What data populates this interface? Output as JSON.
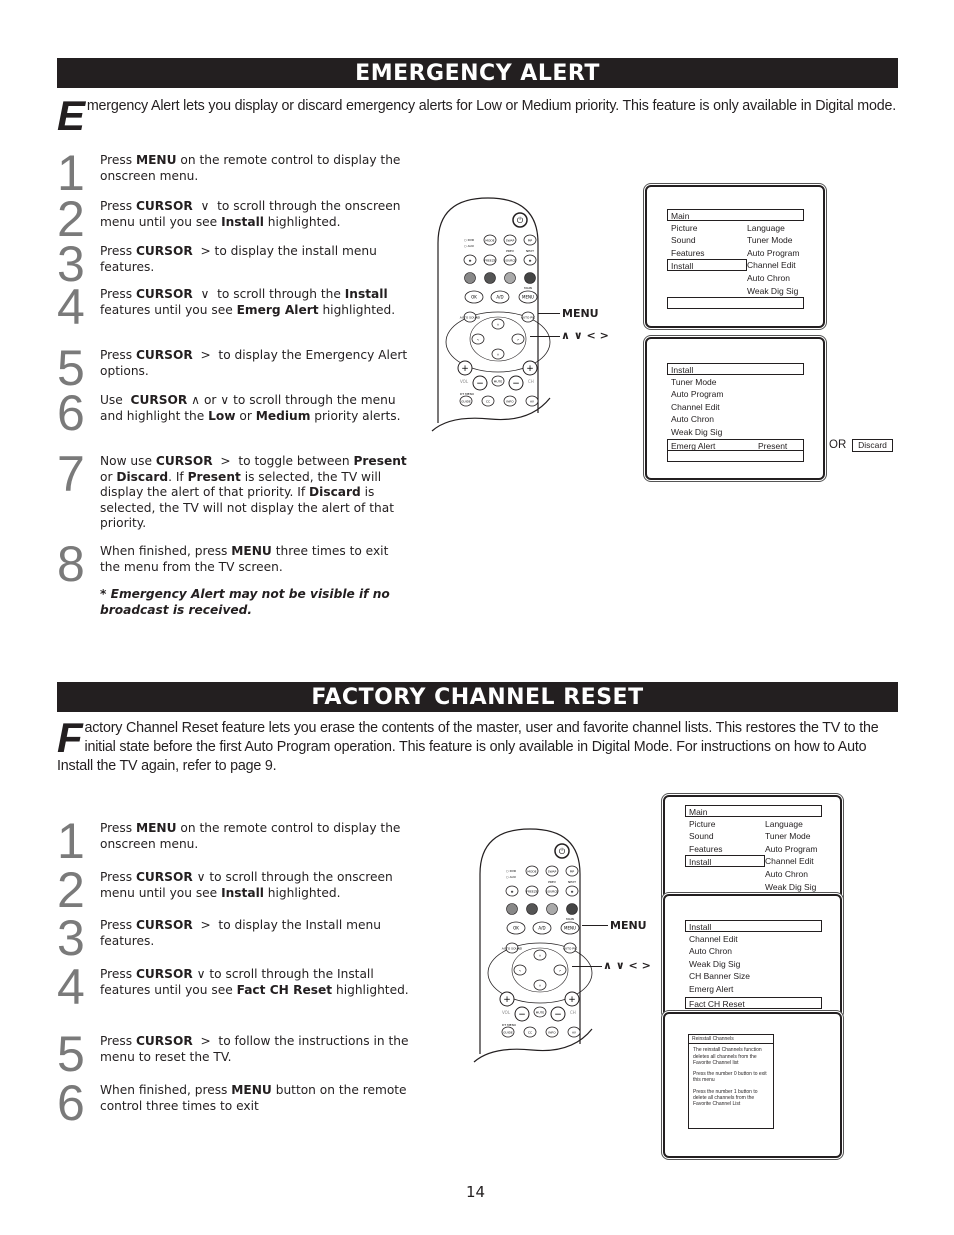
{
  "page_number": "14",
  "emergency_alert": {
    "title": "EMERGENCY ALERT",
    "intro_dropcap": "E",
    "intro": "mergency Alert lets you display or discard emergency alerts for Low or Medium priority.  This feature is only available in Digital mode.",
    "steps": [
      {
        "num": "1",
        "html": "Press <b>MENU</b> on the remote control to display the onscreen menu."
      },
      {
        "num": "2",
        "html": "Press <b>CURSOR</b> &nbsp;∨&nbsp; to scroll through the onscreen menu until you see <b>Install</b> highlighted."
      },
      {
        "num": "3",
        "html": "Press <b>CURSOR</b> &nbsp;&gt; to display the install menu features."
      },
      {
        "num": "4",
        "html": "Press <b>CURSOR</b> &nbsp;∨&nbsp; to scroll through the <b>Install</b> features until you see <b>Emerg Alert</b> highlighted."
      },
      {
        "num": "5",
        "html": "Press <b>CURSOR</b> &nbsp;&gt;&nbsp; to display the Emergency Alert options."
      },
      {
        "num": "6",
        "html": "Use &nbsp;<b>CURSOR</b> ∧ or ∨ to scroll through the menu and highlight the <b>Low</b> or <b>Medium</b> priority alerts."
      },
      {
        "num": "7",
        "html": "Now use <b>CURSOR</b> &nbsp;&gt;&nbsp; to toggle between <b>Present</b> or <b>Discard</b>.  If <b>Present</b> is selected, the TV will display the alert of that priority.   If <b>Discard</b> is selected,  the TV will not display the alert of that priority."
      },
      {
        "num": "8",
        "html": "When finished, press <b>MENU</b> three times to exit the menu from the TV screen."
      }
    ],
    "note": "*  Emergency Alert may not be visible if no broadcast is received.",
    "remote_labels": {
      "menu": "MENU",
      "cursor": "∧  ∨ < >"
    },
    "screen1": {
      "header": "Main",
      "left": [
        "Picture",
        "Sound",
        "Features",
        "Install"
      ],
      "right": [
        "Language",
        "Tuner Mode",
        "Auto Program",
        "Channel Edit",
        "Auto Chron",
        "Weak Dig Sig"
      ],
      "highlighted": "Install"
    },
    "screen2": {
      "header": "Install",
      "items": [
        "Tuner Mode",
        "Auto Program",
        "Channel Edit",
        "Auto Chron",
        "Weak Dig Sig"
      ],
      "selected_item": "Emerg Alert",
      "selected_value": "Present",
      "or_label": "OR",
      "alt_value": "Discard"
    }
  },
  "factory_reset": {
    "title": "FACTORY CHANNEL RESET",
    "intro_dropcap": "F",
    "intro": "actory Channel Reset feature lets you erase the contents of the master, user and favorite channel lists.  This restores the TV to the initial state before the first Auto Program operation.  This feature is only available in Digital Mode.   For instructions on how to Auto Install the TV again, refer to page 9.",
    "steps": [
      {
        "num": "1",
        "html": "Press <b>MENU</b> on the remote control to display the onscreen menu."
      },
      {
        "num": "2",
        "html": "Press <b>CURSOR</b> ∨ to scroll through the onscreen menu until you see <b>Install</b> highlighted."
      },
      {
        "num": "3",
        "html": "Press <b>CURSOR</b> &nbsp;&gt;&nbsp; to display the Install menu features."
      },
      {
        "num": "4",
        "html": "Press <b>CURSOR</b> ∨ to scroll through the Install features until you see <b>Fact CH Reset</b> highlighted."
      },
      {
        "num": "5",
        "html": "Press <b>CURSOR</b> &nbsp;&gt;&nbsp; to follow the instructions in the menu to reset the TV."
      },
      {
        "num": "6",
        "html": "When finished, press <b>MENU</b> button on the remote control three times to exit"
      }
    ],
    "remote_labels": {
      "menu": "MENU",
      "cursor": "∧  ∨ < >"
    },
    "screen1": {
      "header": "Main",
      "left": [
        "Picture",
        "Sound",
        "Features",
        "Install"
      ],
      "right": [
        "Language",
        "Tuner Mode",
        "Auto Program",
        "Channel Edit",
        "Auto Chron",
        "Weak Dig Sig"
      ],
      "highlighted": "Install"
    },
    "screen2": {
      "header": "Install",
      "items": [
        "Channel Edit",
        "Auto Chron",
        "Weak Dig Sig",
        "CH Banner Size",
        "Emerg Alert"
      ],
      "selected_item": "Fact CH Reset"
    },
    "screen3": {
      "title": "Reinstall Channels",
      "paragraphs": [
        "The reinstall Channels function deletes all channels from the Favorite Channel list",
        "Press the number 0 button to exit this menu",
        "Press the number 1 button to delete all channels from the Favorite Channel List"
      ]
    }
  },
  "remote_buttons": {
    "power": "⏻",
    "mode": "MODE",
    "swap": "SWAP",
    "pip": "PIP",
    "dvd": "○ DVD",
    "aux": "○ AUX",
    "freeze": "FREEZE",
    "source": "SOURCE",
    "ok": "OK",
    "ad": "A/D",
    "menu": "MENU",
    "main": "MAIN",
    "auto_sound": "AUTO SOUND",
    "auto_pic": "AUTO PIC",
    "vol": "VOL",
    "ch": "CH",
    "mute": "MUTE",
    "guide": "GUIDE",
    "cc": "CC",
    "info": "INFO",
    "av": "AV",
    "dt_menu": "DT MENU",
    "prev": "PREV",
    "next": "NEXT"
  }
}
